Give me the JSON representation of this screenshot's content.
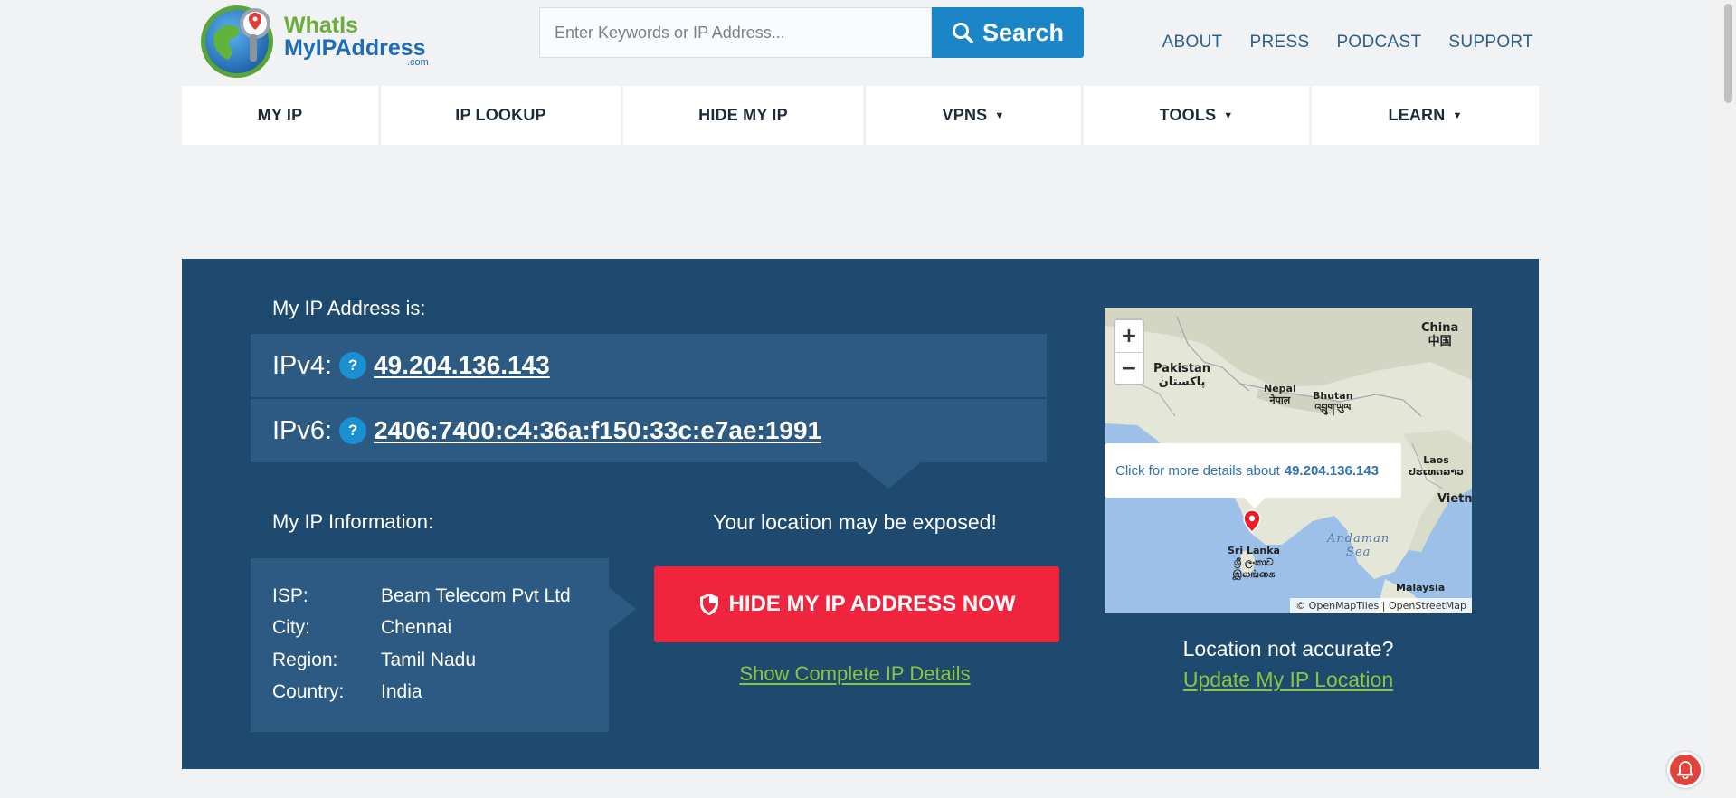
{
  "logo": {
    "line1": "WhatIs",
    "line2": "MyIPAddress",
    "suffix": ".com"
  },
  "search": {
    "placeholder": "Enter Keywords or IP Address...",
    "button_label": "Search",
    "button_icon": "search-icon"
  },
  "top_nav": [
    "ABOUT",
    "PRESS",
    "PODCAST",
    "SUPPORT"
  ],
  "main_nav": [
    {
      "label": "MY IP",
      "dropdown": false
    },
    {
      "label": "IP LOOKUP",
      "dropdown": false
    },
    {
      "label": "HIDE MY IP",
      "dropdown": false
    },
    {
      "label": "VPNS",
      "dropdown": true
    },
    {
      "label": "TOOLS",
      "dropdown": true
    },
    {
      "label": "LEARN",
      "dropdown": true
    }
  ],
  "hero": {
    "my_ip_heading": "My IP Address is:",
    "ipv4_label": "IPv4:",
    "ipv4_value": "49.204.136.143",
    "ipv6_label": "IPv6:",
    "ipv6_value": "2406:7400:c4:36a:f150:33c:e7ae:1991",
    "help_icon_text": "?",
    "info_heading": "My IP Information:",
    "info": [
      {
        "key": "ISP:",
        "value": "Beam Telecom Pvt Ltd"
      },
      {
        "key": "City:",
        "value": "Chennai"
      },
      {
        "key": "Region:",
        "value": "Tamil Nadu"
      },
      {
        "key": "Country:",
        "value": "India"
      }
    ],
    "exposed_text": "Your location may be exposed!",
    "hide_button_label": "HIDE MY IP ADDRESS NOW",
    "show_details_link": "Show Complete IP Details",
    "location_question": "Location not accurate?",
    "update_location_link": "Update My IP Location"
  },
  "map": {
    "zoom_in": "+",
    "zoom_out": "−",
    "popup_prefix": "Click for more details about",
    "popup_ip": "49.204.136.143",
    "attribution": "© OpenMapTiles | OpenStreetMap",
    "labels": {
      "china": "China",
      "china_native": "中国",
      "pakistan": "Pakistan",
      "pakistan_native": "پاکستان",
      "nepal": "Nepal",
      "nepal_native": "नेपाल",
      "bhutan": "Bhutan",
      "bhutan_native": "འབྲུག་ཡུལ",
      "laos": "Laos",
      "laos_native": "ປະເທດລາວ",
      "vietnam": "Vietn",
      "sri_lanka": "Sri Lanka",
      "sri_lanka_native1": "ශ්‍රී ලංකාව",
      "sri_lanka_native2": "இலங்கை",
      "andaman": "Andaman",
      "sea": "Sea",
      "malaysia": "Malaysia"
    }
  },
  "colors": {
    "brand_blue": "#1a86c8",
    "hero_bg": "#1e4a70",
    "hero_box": "#2c5a82",
    "hide_red": "#f0243d",
    "link_green": "#8bc53f"
  }
}
